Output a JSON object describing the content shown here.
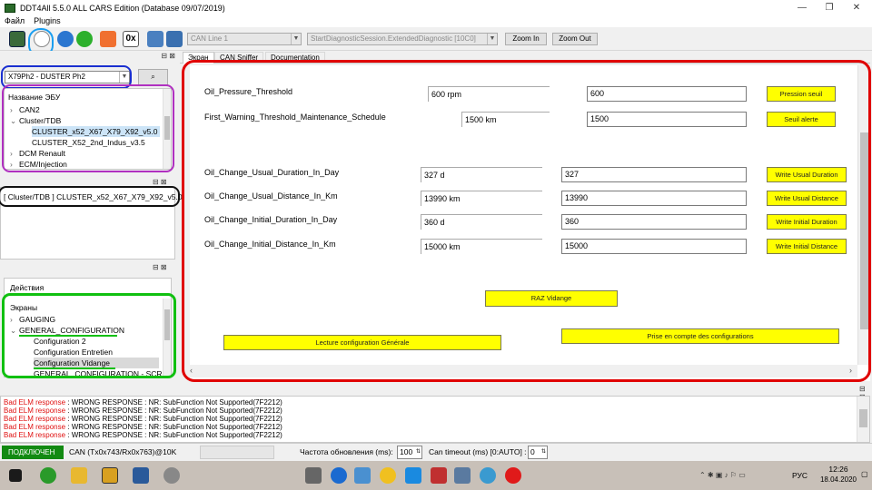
{
  "window": {
    "title": "DDT4All 5.5.0 ALL CARS Edition (Database 09/07/2019)",
    "controls": [
      "—",
      "❐",
      "✕"
    ]
  },
  "menu": [
    "Файл",
    "Plugins"
  ],
  "toolbar": {
    "can_line": "CAN Line 1",
    "session": "StartDiagnosticSession.ExtendedDiagnostic [10C0]",
    "zoom_in": "Zoom In",
    "zoom_out": "Zoom Out",
    "hex_label": "0x"
  },
  "tabs": [
    "Экран",
    "CAN Sniffer",
    "Documentation"
  ],
  "left": {
    "vehicle": "X79Ph2 - DUSTER Ph2",
    "ecu_header": "Название ЭБУ",
    "ecu_tree": [
      {
        "label": "CAN2",
        "chev": "›"
      },
      {
        "label": "Cluster/TDB",
        "chev": "⌄"
      },
      {
        "label": "CLUSTER_x52_X67_X79_X92_v5.0",
        "chev": ""
      },
      {
        "label": "CLUSTER_X52_2nd_Indus_v3.5",
        "chev": ""
      },
      {
        "label": "DCM Renault",
        "chev": "›"
      },
      {
        "label": "ECM/Injection",
        "chev": "›"
      }
    ],
    "selected_ecu": "[ Cluster/TDB ] CLUSTER_x52_X67_X79_X92_v5.0",
    "actions_header": "Действия",
    "screens_header": "Экраны",
    "screen_tree": [
      {
        "label": "GAUGING",
        "chev": "›"
      },
      {
        "label": "GENERAL_CONFIGURATION",
        "chev": "⌄"
      },
      {
        "label": "Configuration 2",
        "chev": ""
      },
      {
        "label": "Configuration Entretien",
        "chev": ""
      },
      {
        "label": "Configuration Vidange",
        "chev": ""
      },
      {
        "label": "GENERAL_CONFIGURATION - SCR...",
        "chev": ""
      }
    ],
    "panel_btns": "⊟ ⊠"
  },
  "main": {
    "rows": [
      {
        "label": "Oil_Pressure_Threshold",
        "value": "600 rpm",
        "input": "600",
        "button": "Pression seuil"
      },
      {
        "label": "First_Warning_Threshold_Maintenance_Schedule",
        "value": "1500 km",
        "input": "1500",
        "button": "Seuil alerte"
      },
      {
        "label": "Oil_Change_Usual_Duration_In_Day",
        "value": "327 d",
        "input": "327",
        "button": "Write Usual Duration"
      },
      {
        "label": "Oil_Change_Usual_Distance_In_Km",
        "value": "13990 km",
        "input": "13990",
        "button": "Write Usual Distance"
      },
      {
        "label": "Oil_Change_Initial_Duration_In_Day",
        "value": "360 d",
        "input": "360",
        "button": "Write Initial Duration"
      },
      {
        "label": "Oil_Change_Initial_Distance_In_Km",
        "value": "15000 km",
        "input": "15000",
        "button": "Write Initial Distance"
      }
    ],
    "raz": "RAZ Vidange",
    "lecture": "Lecture configuration Générale",
    "prise": "Prise en compte des configurations"
  },
  "log": [
    {
      "err": "Bad ELM response",
      "msg": " : WRONG RESPONSE : NR: SubFunction Not Supported(7F2212)"
    },
    {
      "err": "Bad ELM response",
      "msg": " : WRONG RESPONSE : NR: SubFunction Not Supported(7F2212)"
    },
    {
      "err": "Bad ELM response",
      "msg": " : WRONG RESPONSE : NR: SubFunction Not Supported(7F2212)"
    },
    {
      "err": "Bad ELM response",
      "msg": " : WRONG RESPONSE : NR: SubFunction Not Supported(7F2212)"
    },
    {
      "err": "Bad ELM response",
      "msg": " : WRONG RESPONSE : NR: SubFunction Not Supported(7F2212)"
    }
  ],
  "status": {
    "connected": "ПОДКЛЮЧЕН",
    "can": "CAN (Tx0x743/Rx0x763)@10K",
    "refresh_label": "Частота обновления (ms):",
    "refresh_value": "100",
    "timeout_label": "Can timeout (ms) [0:AUTO] :",
    "timeout_value": "0"
  },
  "taskbar": {
    "lang": "РУС",
    "time": "12:26",
    "date": "18.04.2020"
  },
  "colors": {
    "highlight_red": "#e00000",
    "highlight_blue": "#1a2fd0",
    "highlight_purple": "#b030c0",
    "highlight_green": "#10c010",
    "yellow_button": "#ffff00",
    "connected_green": "#128a12"
  }
}
